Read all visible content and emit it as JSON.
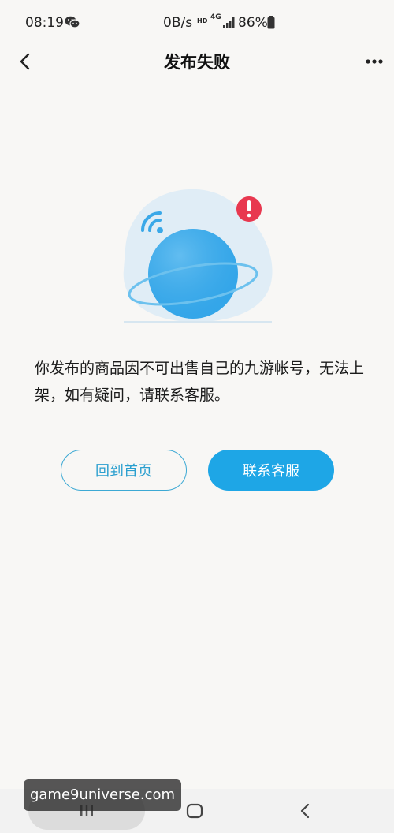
{
  "status_bar": {
    "time": "08:19",
    "network_speed": "0B/s",
    "hd": "HD",
    "network_type": "4G",
    "battery": "86%"
  },
  "nav": {
    "title": "发布失败"
  },
  "main": {
    "message": "你发布的商品因不可出售自己的九游帐号，无法上架，如有疑问，请联系客服。",
    "home_button": "回到首页",
    "contact_button": "联系客服"
  },
  "watermark": {
    "text": "game9universe.com"
  },
  "colors": {
    "accent": "#1ea6e6",
    "outline": "#3da9d4",
    "error": "#e8384f",
    "background": "#f8f7f5"
  },
  "icons": {
    "status": [
      "wechat-icon",
      "signal-icon",
      "battery-icon"
    ],
    "nav": [
      "back-arrow-icon",
      "more-dots-icon"
    ],
    "illustration": [
      "wifi-icon",
      "error-alert-icon",
      "planet-icon"
    ],
    "system_nav": [
      "recent-apps-icon",
      "home-icon",
      "back-icon"
    ]
  }
}
